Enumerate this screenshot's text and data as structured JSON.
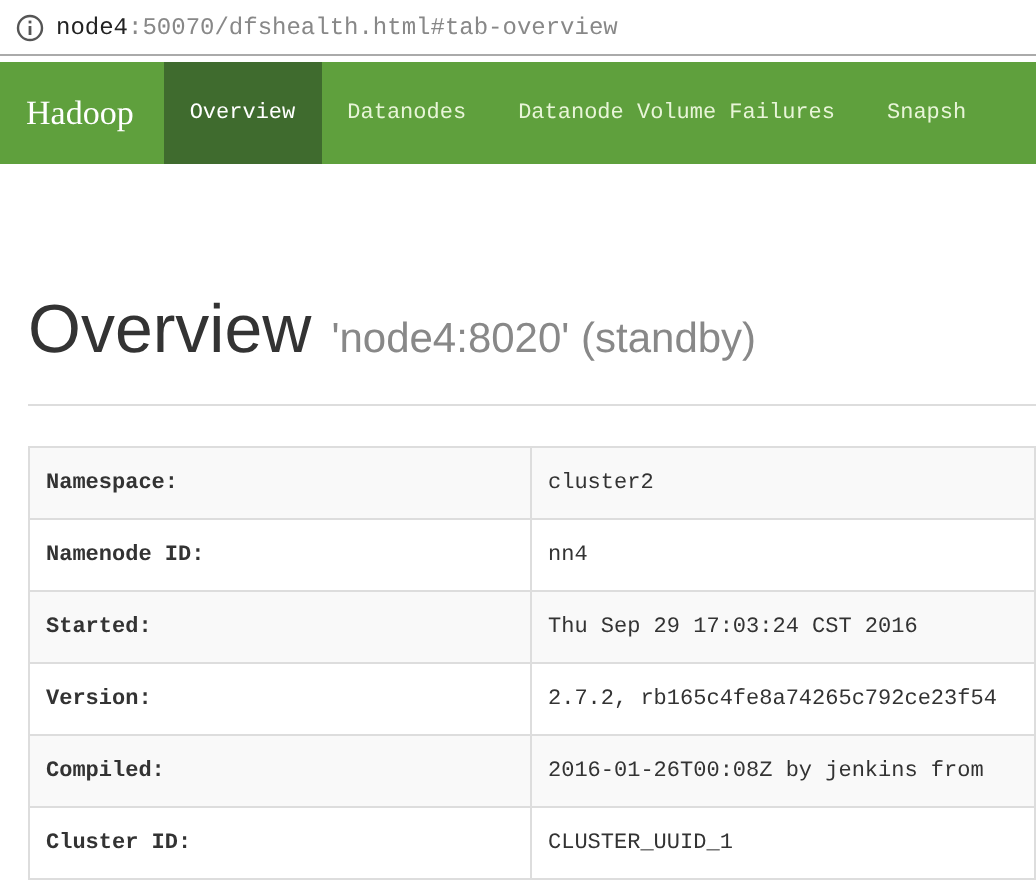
{
  "address_bar": {
    "host": "node4",
    "path": ":50070/dfshealth.html#tab-overview"
  },
  "navbar": {
    "brand": "Hadoop",
    "tabs": [
      {
        "label": "Overview",
        "selected": true
      },
      {
        "label": "Datanodes",
        "selected": false
      },
      {
        "label": "Datanode Volume Failures",
        "selected": false
      },
      {
        "label": "Snapsh",
        "selected": false
      }
    ]
  },
  "page_header": {
    "title": "Overview",
    "subtitle": "'node4:8020' (standby)"
  },
  "table": {
    "rows": [
      {
        "label": "Namespace:",
        "value": "cluster2"
      },
      {
        "label": "Namenode ID:",
        "value": "nn4"
      },
      {
        "label": "Started:",
        "value": "Thu Sep 29 17:03:24 CST 2016"
      },
      {
        "label": "Version:",
        "value": "2.7.2, rb165c4fe8a74265c792ce23f54"
      },
      {
        "label": "Compiled:",
        "value": "2016-01-26T00:08Z by jenkins from"
      },
      {
        "label": "Cluster ID:",
        "value": "CLUSTER_UUID_1"
      }
    ]
  }
}
